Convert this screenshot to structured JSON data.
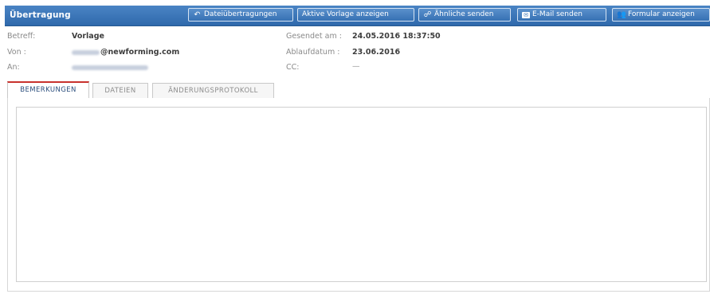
{
  "header": {
    "title": "Übertragung",
    "buttons": [
      {
        "label": "Dateiübertragungen",
        "icon": "reply-icon"
      },
      {
        "label": "Aktive Vorlage anzeigen",
        "icon": ""
      },
      {
        "label": "Ähnliche senden",
        "icon": "link-icon"
      },
      {
        "label": "E-Mail senden",
        "icon": "envelope-icon"
      },
      {
        "label": "Formular anzeigen",
        "icon": "people-icon"
      }
    ],
    "color": "#3a73b5"
  },
  "details": {
    "subject_label": "Betreff:",
    "subject_value": "Vorlage",
    "from_label": "Von :",
    "from_value": "@newforming.com",
    "to_label": "An:",
    "sent_label": "Gesendet am :",
    "sent_value": "24.05.2016 18:37:50",
    "expiry_label": "Ablaufdatum :",
    "expiry_value": "23.06.2016",
    "cc_label": "CC:",
    "cc_value": "—"
  },
  "tabs": [
    {
      "label": "BEMERKUNGEN",
      "active": true
    },
    {
      "label": "DATEIEN",
      "active": false
    },
    {
      "label": "ÄNDERUNGSPROTOKOLL",
      "active": false
    }
  ],
  "accent": {
    "active_tab": "#c8322d"
  }
}
